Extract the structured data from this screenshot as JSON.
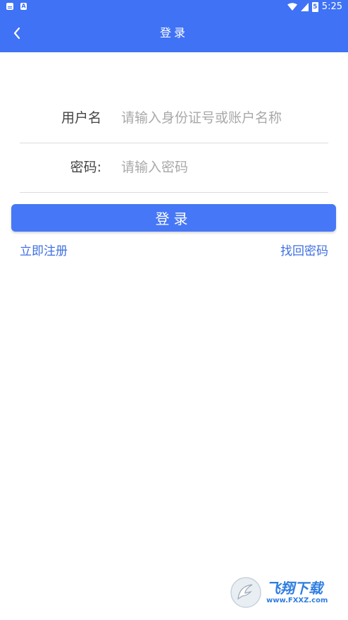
{
  "status_bar": {
    "time": "5:25",
    "battery": "5"
  },
  "app_bar": {
    "title": "登录",
    "back_icon": "chevron-left-icon"
  },
  "form": {
    "username_label": "用户名",
    "username_placeholder": "请输入身份证号或账户名称",
    "username_value": "",
    "password_label": "密码:",
    "password_placeholder": "请输入密码",
    "password_value": ""
  },
  "login_button": {
    "label": "登录"
  },
  "links": {
    "register": "立即注册",
    "forgot_password": "找回密码"
  },
  "watermark": {
    "brand": "飞翔下载",
    "url": "www.FXXZ.com"
  },
  "colors": {
    "primary": "#3f72f5",
    "button": "#4677f7",
    "link": "#3e6fe0",
    "placeholder": "#a9a9a9"
  }
}
